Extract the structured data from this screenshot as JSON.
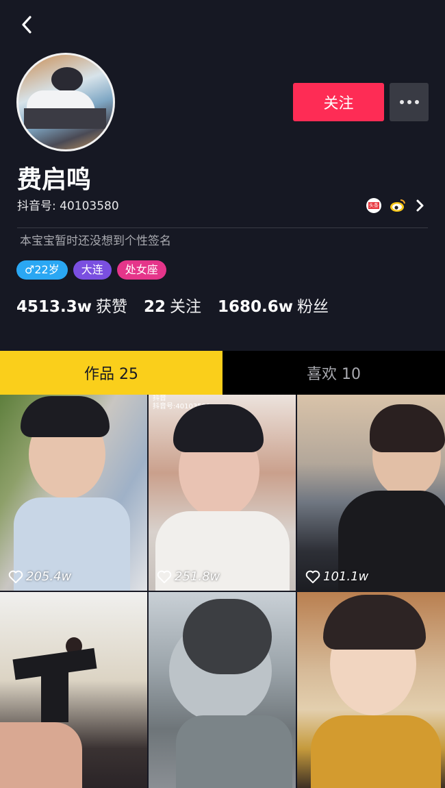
{
  "header": {
    "follow_label": "关注",
    "more_label": "•••"
  },
  "profile": {
    "name": "费启鸣",
    "douyin_id": "抖音号: 40103580",
    "signature": "本宝宝暂时还没想到个性签名",
    "toutiao_badge": "头条",
    "tags": {
      "gender_age": "♂22岁",
      "city": "大连",
      "zodiac": "处女座"
    },
    "stats": {
      "likes_num": "4513.3w",
      "likes_label": "获赞",
      "following_num": "22",
      "following_label": "关注",
      "fans_num": "1680.6w",
      "fans_label": "粉丝"
    }
  },
  "tabs": {
    "works": "作品 25",
    "likes": "喜欢 10"
  },
  "videos": [
    {
      "likes": "205.4w"
    },
    {
      "likes": "251.8w",
      "watermark_app": "抖音",
      "watermark_id": "抖音号:40103580"
    },
    {
      "likes": "101.1w"
    },
    {
      "likes": ""
    },
    {
      "likes": ""
    },
    {
      "likes": ""
    }
  ],
  "colors": {
    "background": "#161823",
    "accent": "#fe2c55",
    "tab_active": "#facf1b"
  },
  "icons": [
    "back-arrow-icon",
    "more-dots-icon",
    "toutiao-icon",
    "weibo-icon",
    "chevron-right-icon",
    "heart-icon"
  ]
}
